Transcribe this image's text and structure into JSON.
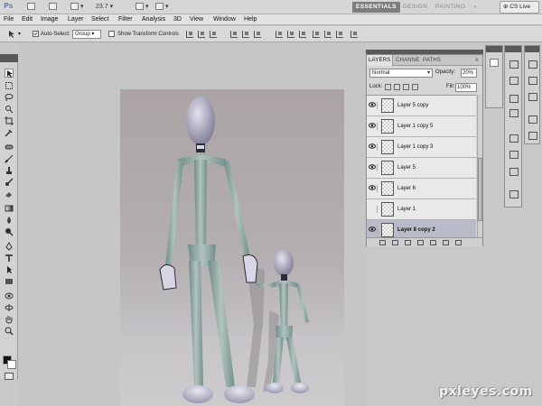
{
  "app": {
    "logo": "Ps"
  },
  "appbar": {
    "zoom": "23.7",
    "workspaces": [
      {
        "label": "ESSENTIALS",
        "active": true
      },
      {
        "label": "DESIGN",
        "active": false
      },
      {
        "label": "PAINTING",
        "active": false
      }
    ],
    "more": "»",
    "cs_live": "CS Live"
  },
  "menu": [
    "File",
    "Edit",
    "Image",
    "Layer",
    "Select",
    "Filter",
    "Analysis",
    "3D",
    "View",
    "Window",
    "Help"
  ],
  "options": {
    "auto_select_label": "Auto-Select:",
    "auto_select_value": "Group",
    "show_transform_label": "Show Transform Controls"
  },
  "layers_panel": {
    "tabs": [
      {
        "label": "LAYERS",
        "active": true
      },
      {
        "label": "CHANNE",
        "active": false
      },
      {
        "label": "PATHS",
        "active": false
      }
    ],
    "blend_mode": "Normal",
    "opacity_label": "Opacity:",
    "opacity": "20%",
    "lock_label": "Lock:",
    "fill_label": "Fill:",
    "fill": "100%",
    "layers": [
      {
        "name": "Layer 5 copy",
        "visible": true,
        "selected": false
      },
      {
        "name": "Layer 1 copy 5",
        "visible": true,
        "selected": false
      },
      {
        "name": "Layer 1 copy 3",
        "visible": true,
        "selected": false
      },
      {
        "name": "Layer 5",
        "visible": true,
        "selected": false
      },
      {
        "name": "Layer 6",
        "visible": true,
        "selected": false
      },
      {
        "name": "Layer 1",
        "visible": false,
        "selected": false
      },
      {
        "name": "Layer 8 copy 2",
        "visible": true,
        "selected": true
      }
    ]
  },
  "watermark": "pxleyes.com",
  "colors": {
    "foreground": "#111111",
    "background": "#ffffff",
    "active_workspace": "#7d7d7d",
    "selected_layer": "#b9bcc8"
  }
}
